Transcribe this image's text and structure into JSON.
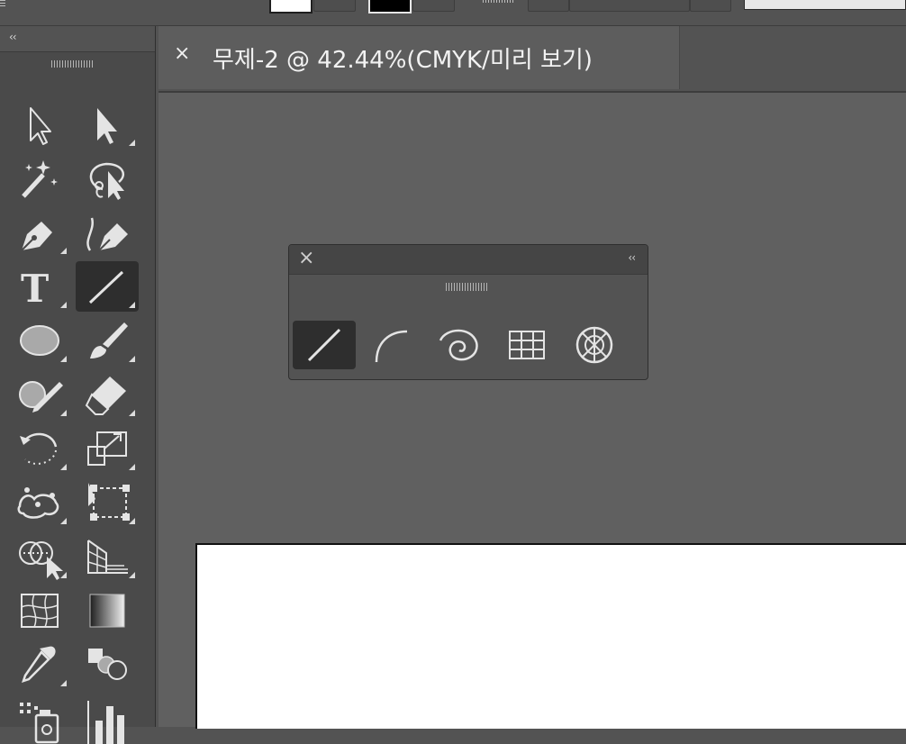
{
  "document": {
    "tab_close": "×",
    "tab_title": "무제-2 @ 42.44%(CMYK/미리 보기)"
  },
  "tools_panel": {
    "collapse": "‹‹",
    "tools": [
      {
        "icon": "selection-icon"
      },
      {
        "icon": "direct-selection-icon"
      },
      {
        "icon": "magic-wand-icon"
      },
      {
        "icon": "lasso-icon"
      },
      {
        "icon": "pen-icon"
      },
      {
        "icon": "curvature-icon"
      },
      {
        "icon": "type-icon",
        "glyph": "T"
      },
      {
        "icon": "line-segment-icon"
      },
      {
        "icon": "ellipse-icon"
      },
      {
        "icon": "paintbrush-icon"
      },
      {
        "icon": "shaper-icon"
      },
      {
        "icon": "eraser-icon"
      },
      {
        "icon": "rotate-icon"
      },
      {
        "icon": "scale-icon"
      },
      {
        "icon": "puppet-warp-icon"
      },
      {
        "icon": "free-transform-icon"
      },
      {
        "icon": "shape-builder-icon"
      },
      {
        "icon": "perspective-grid-icon"
      },
      {
        "icon": "mesh-icon"
      },
      {
        "icon": "gradient-icon"
      },
      {
        "icon": "eyedropper-icon"
      },
      {
        "icon": "blend-icon"
      },
      {
        "icon": "symbol-sprayer-icon"
      },
      {
        "icon": "column-graph-icon"
      }
    ]
  },
  "line_tools_panel": {
    "close": "×",
    "collapse": "‹‹",
    "tools": [
      {
        "icon": "line-segment-icon"
      },
      {
        "icon": "arc-icon"
      },
      {
        "icon": "spiral-icon"
      },
      {
        "icon": "rectangular-grid-icon"
      },
      {
        "icon": "polar-grid-icon"
      }
    ]
  },
  "colors": {
    "panel": "#4a4a4a",
    "workspace": "#606060",
    "active_tool": "#2e2e2e",
    "artboard": "#ffffff"
  }
}
